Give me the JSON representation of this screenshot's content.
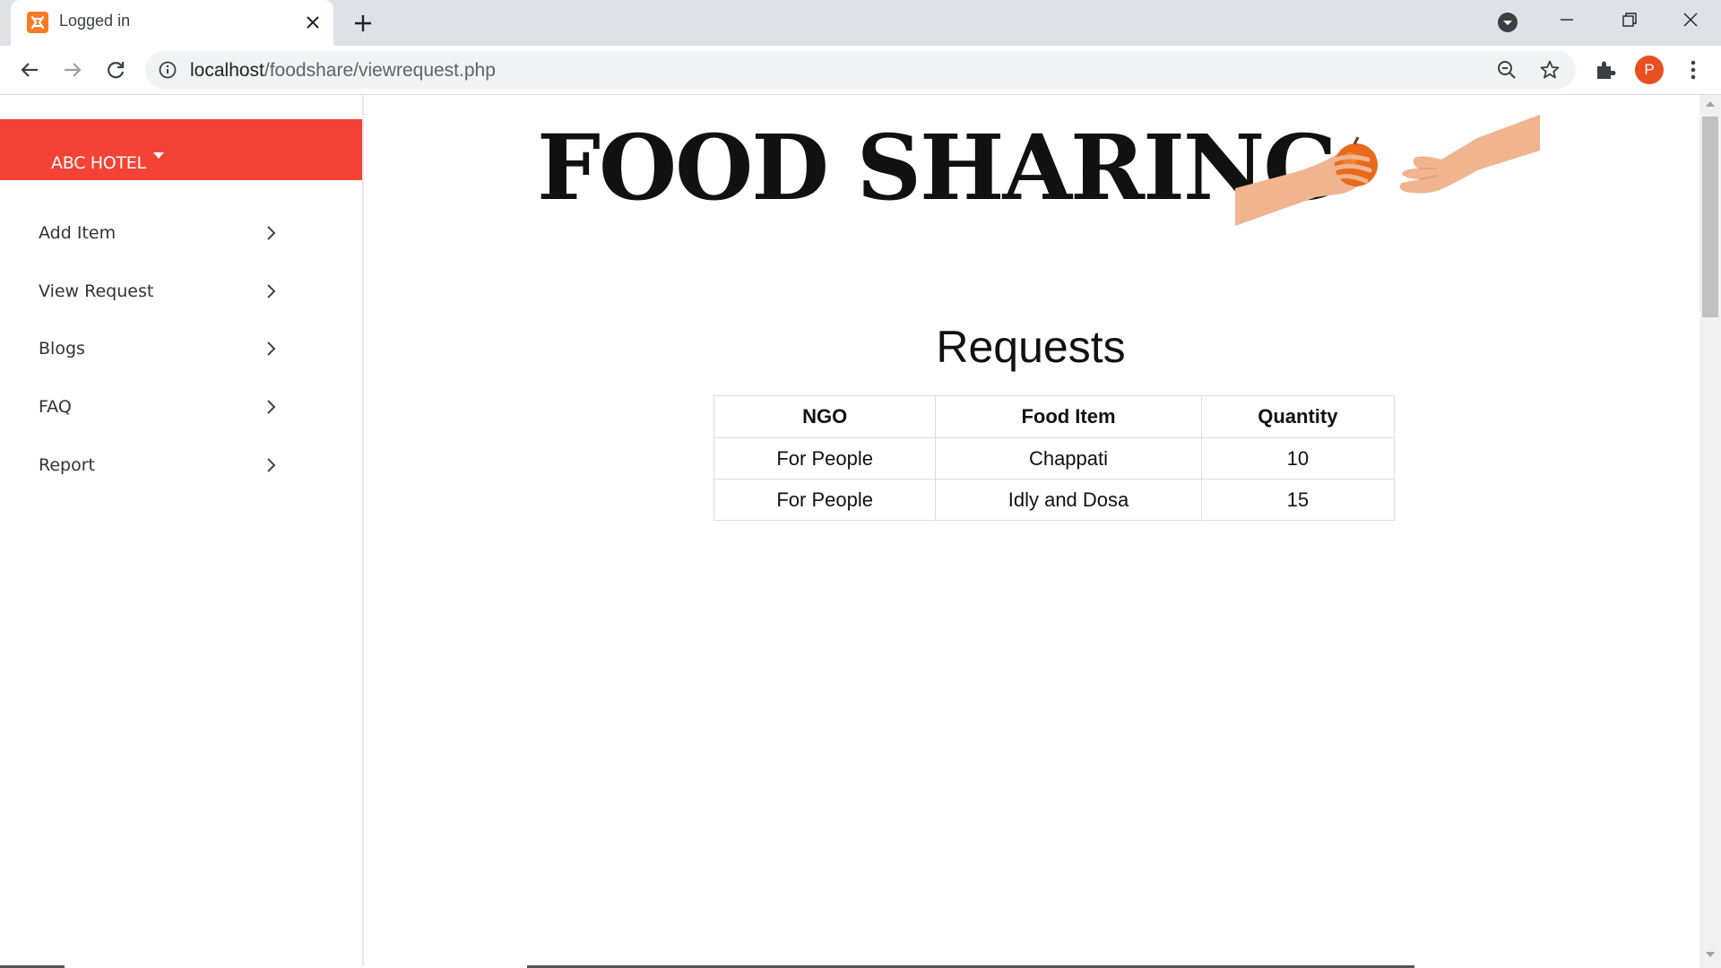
{
  "browser": {
    "tab_title": "Logged in",
    "url_host": "localhost",
    "url_path": "/foodshare/viewrequest.php",
    "profile_initial": "P",
    "favicon_icon": "xampp-icon"
  },
  "sidebar": {
    "brand": "ABC HOTEL",
    "header_color": "#f44336",
    "items": [
      {
        "label": "Add Item"
      },
      {
        "label": "View Request"
      },
      {
        "label": "Blogs"
      },
      {
        "label": "FAQ"
      },
      {
        "label": "Report"
      }
    ]
  },
  "main": {
    "title": "FOOD SHARING",
    "section_title": "Requests",
    "table": {
      "headers": [
        "NGO",
        "Food Item",
        "Quantity"
      ],
      "rows": [
        [
          "For People",
          "Chappati",
          "10"
        ],
        [
          "For People",
          "Idly and Dosa",
          "15"
        ]
      ]
    }
  }
}
